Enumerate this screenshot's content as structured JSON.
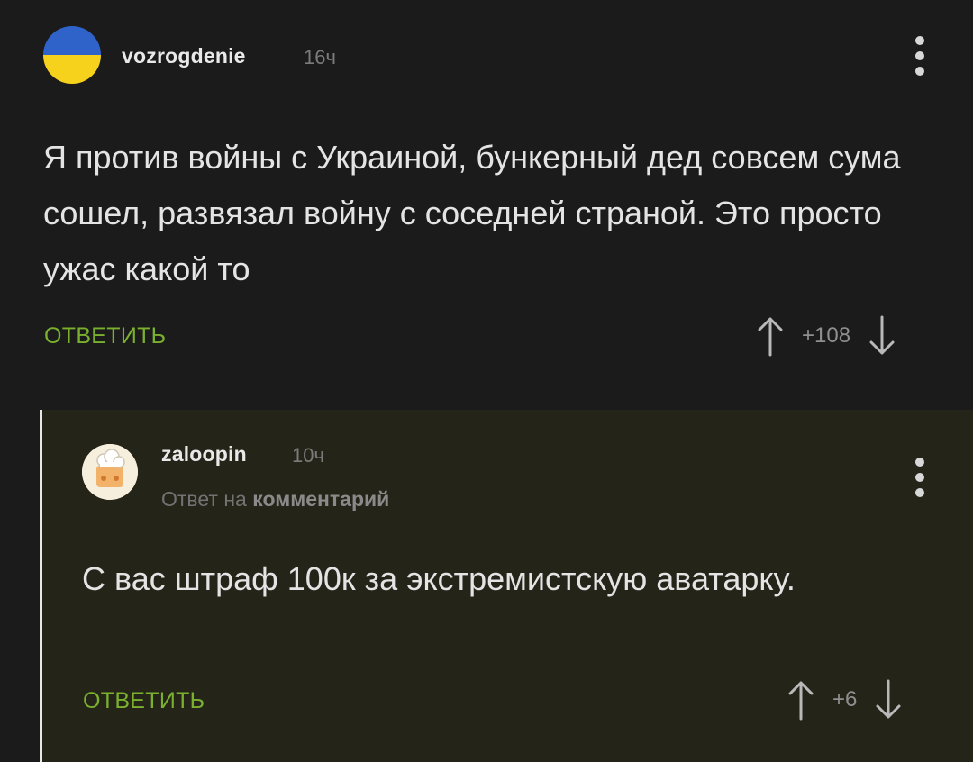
{
  "comments": [
    {
      "author": "vozrogdenie",
      "time": "16ч",
      "text": "Я против войны с Украиной, бункерный дед совсем сума сошел, развязал войну с соседней страной. Это просто ужас какой то",
      "reply_label": "ОТВЕТИТЬ",
      "score": "+108",
      "avatar_colors": {
        "top": "#2f63c9",
        "bottom": "#f7d21c"
      }
    },
    {
      "author": "zaloopin",
      "time": "10ч",
      "reply_prefix": "Ответ на",
      "reply_target": "комментарий",
      "text": "С вас штраф 100к за экстремистскую аватарку.",
      "reply_label": "ОТВЕТИТЬ",
      "score": "+6"
    }
  ],
  "icons": {
    "upvote": "arrow-up-icon",
    "downvote": "arrow-down-icon",
    "menu": "more-vertical-icon"
  },
  "colors": {
    "accent": "#7ab02e",
    "background": "#1b1b1b",
    "reply_background": "#252419"
  }
}
